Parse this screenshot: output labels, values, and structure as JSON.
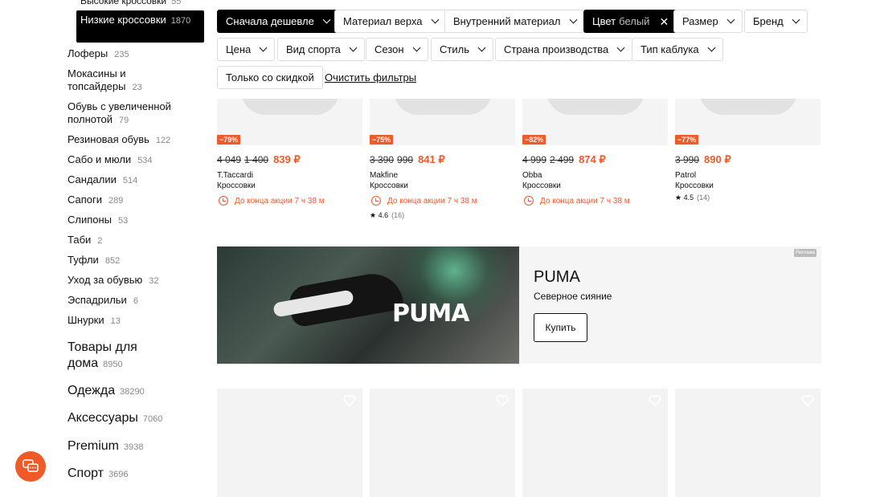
{
  "sidebar": {
    "top_partial": {
      "label": "Высокие кроссовки",
      "count": "55"
    },
    "active": {
      "label": "Низкие кроссовки",
      "count": "1870"
    },
    "items": [
      {
        "label": "Лоферы",
        "count": "235"
      },
      {
        "label": "Мокасины и топсайдеры",
        "count": "23"
      },
      {
        "label": "Обувь с увеличенной полнотой",
        "count": "79"
      },
      {
        "label": "Резиновая обувь",
        "count": "122"
      },
      {
        "label": "Сабо и мюли",
        "count": "534"
      },
      {
        "label": "Сандалии",
        "count": "514"
      },
      {
        "label": "Сапоги",
        "count": "289"
      },
      {
        "label": "Слипоны",
        "count": "53"
      },
      {
        "label": "Таби",
        "count": "2"
      },
      {
        "label": "Туфли",
        "count": "852"
      },
      {
        "label": "Уход за обувью",
        "count": "32"
      },
      {
        "label": "Эспадрильи",
        "count": "6"
      },
      {
        "label": "Шнурки",
        "count": "13"
      }
    ],
    "sections": [
      {
        "label": "Товары для дома",
        "count": "8950"
      },
      {
        "label": "Одежда",
        "count": "38290"
      },
      {
        "label": "Аксессуары",
        "count": "7060"
      },
      {
        "label": "Premium",
        "count": "3938"
      },
      {
        "label": "Спорт",
        "count": "3696"
      }
    ]
  },
  "filters": {
    "sort": "Сначала дешевле",
    "material_top": "Материал верха",
    "material_inner": "Внутренний материал",
    "color_label": "Цвет",
    "color_value": "белый",
    "size": "Размер",
    "brand": "Бренд",
    "price": "Цена",
    "sport": "Вид спорта",
    "season": "Сезон",
    "style": "Стиль",
    "country": "Страна производства",
    "heel": "Тип каблука",
    "discount_only": "Только со скидкой",
    "clear": "Очистить фильтры"
  },
  "products": [
    {
      "discount": "−79%",
      "old1": "4 049",
      "old2": "1 400",
      "price": "839 ₽",
      "brand": "T.Taccardi",
      "type": "Кроссовки",
      "timer": "До конца акции 7 ч 38 м"
    },
    {
      "discount": "−75%",
      "old1": "3 390",
      "old2": "990",
      "price": "841 ₽",
      "brand": "Makfine",
      "type": "Кроссовки",
      "timer": "До конца акции 7 ч 38 м",
      "rating": "4.6",
      "reviews": "(16)"
    },
    {
      "discount": "−82%",
      "old1": "4 999",
      "old2": "2 499",
      "price": "874 ₽",
      "brand": "Obba",
      "type": "Кроссовки",
      "timer": "До конца акции 7 ч 38 м"
    },
    {
      "discount": "−77%",
      "old1": "3 990",
      "old2": "",
      "price": "890 ₽",
      "brand": "Patrol",
      "type": "Кроссовки",
      "rating": "4.5",
      "reviews": "(14)"
    }
  ],
  "banner": {
    "logo": "PUMA",
    "title": "PUMA",
    "subtitle": "Северное сияние",
    "button": "Купить",
    "ad_tag": "Реклама"
  },
  "colors": {
    "accent": "#f05a28",
    "dark": "#000000"
  }
}
